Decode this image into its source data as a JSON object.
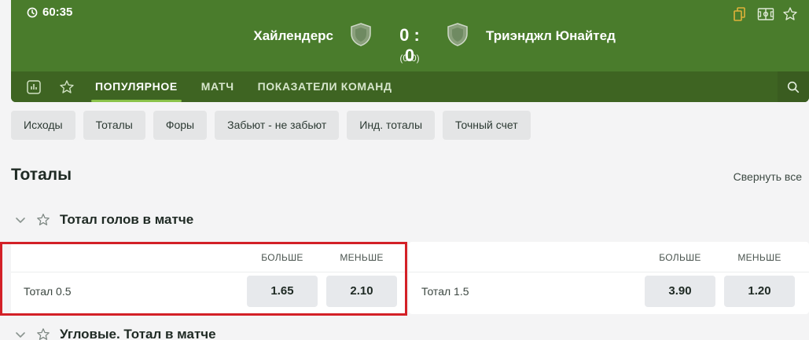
{
  "header": {
    "timer": "60:35",
    "home_team": "Хайлендерс",
    "away_team": "Триэнджл Юнайтед",
    "score": "0 : 0",
    "subscore": "(0-0)",
    "icons": [
      "copy-icon",
      "field-icon",
      "star-icon"
    ]
  },
  "nav": {
    "tabs": [
      {
        "label": "ПОПУЛЯРНОЕ",
        "active": true
      },
      {
        "label": "МАТЧ",
        "active": false
      },
      {
        "label": "ПОКАЗАТЕЛИ КОМАНД",
        "active": false
      }
    ],
    "icons": [
      "stats-icon",
      "star-icon",
      "search-icon"
    ]
  },
  "chips": [
    "Исходы",
    "Тоталы",
    "Форы",
    "Забьют - не забьют",
    "Инд. тоталы",
    "Точный счет"
  ],
  "section": {
    "title": "Тоталы",
    "collapse_all": "Свернуть все"
  },
  "market1": {
    "title": "Тотал голов в матче",
    "over_label": "БОЛЬШЕ",
    "under_label": "МЕНЬШЕ",
    "lines": [
      {
        "label": "Тотал 0.5",
        "over": "1.65",
        "under": "2.10"
      },
      {
        "label": "Тотал 1.5",
        "over": "3.90",
        "under": "1.20"
      }
    ]
  },
  "market2": {
    "title": "Угловые. Тотал в матче"
  },
  "colors": {
    "header_green": "#4a7c2c",
    "nav_green": "#3e6422",
    "highlight_red": "#d32027"
  }
}
